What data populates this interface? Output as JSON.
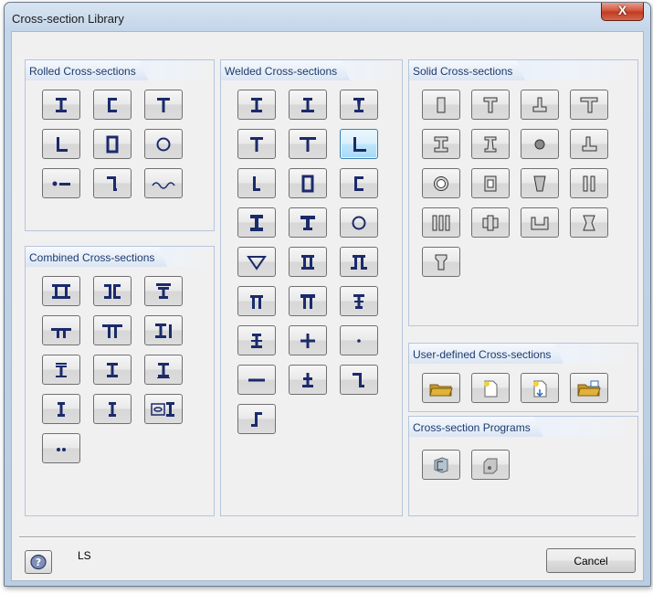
{
  "window": {
    "title": "Cross-section Library",
    "close_label": "X"
  },
  "groups": {
    "rolled": {
      "title": "Rolled Cross-sections",
      "items": [
        "i-section",
        "channel-section",
        "t-section",
        "angle-section",
        "rectangular-hollow-section",
        "circular-hollow-section",
        "round-bar",
        "z-section",
        "thin-walled-profile"
      ]
    },
    "combined": {
      "title": "Combined Cross-sections",
      "items": [
        "double-i",
        "back-to-back-channels",
        "t-with-plate",
        "double-t",
        "double-t-wide",
        "i-with-flat",
        "i-with-cap",
        "i-plain",
        "i-with-plate-bottom",
        "i-tapered",
        "i-small",
        "i-in-box",
        "double-round-bars"
      ]
    },
    "welded": {
      "title": "Welded Cross-sections",
      "items": [
        "welded-i-symmetric",
        "welded-i-asymmetric",
        "welded-i-tapered",
        "welded-t",
        "welded-t-wide",
        "welded-angle",
        "welded-l-flange",
        "welded-box",
        "welded-channel",
        "welded-i-heavy",
        "welded-t-heavy",
        "welded-tube",
        "welded-trapezoid-box",
        "welded-box-flanged",
        "welded-hat-box",
        "welded-pi",
        "welded-pi-heavy",
        "welded-i-stiffened",
        "welded-cruciform-i",
        "welded-cross",
        "welded-round-bar",
        "welded-flat-bar",
        "welded-t-stiffened",
        "welded-z",
        "welded-z-step"
      ]
    },
    "solid": {
      "title": "Solid Cross-sections",
      "items": [
        "solid-rectangle",
        "solid-t",
        "solid-inverted-t",
        "solid-t-wide",
        "solid-i",
        "solid-i-tapered",
        "solid-circle",
        "solid-l",
        "solid-hollow-circle",
        "solid-hollow-rectangle",
        "solid-trapezoid",
        "solid-double-rectangle",
        "solid-triple-rectangle",
        "solid-cross-rectangle",
        "solid-u-channel",
        "solid-double-trapezoid",
        "solid-funnel"
      ]
    },
    "user": {
      "title": "User-defined Cross-sections",
      "items": [
        "open-folder",
        "new-section",
        "new-section-import",
        "folder-export"
      ]
    },
    "programs": {
      "title": "Cross-section Programs",
      "items": [
        "shape-thin-program",
        "shape-massive-program"
      ]
    }
  },
  "selected_item": "welded-angle",
  "footer": {
    "status_text": "LS",
    "cancel_label": "Cancel"
  },
  "colors": {
    "icon_blue": "#1b2a6b",
    "solid_gray": "#8a8a8a",
    "folder_gold": "#e1b23a",
    "tab_text": "#1e3a6e"
  }
}
